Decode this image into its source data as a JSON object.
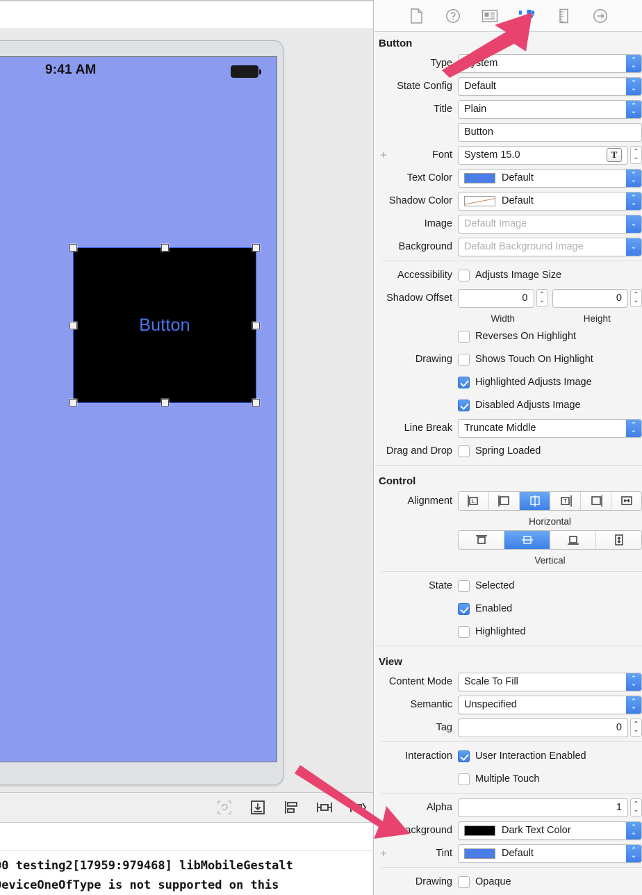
{
  "canvas": {
    "status_time": "9:41 AM",
    "button_label": "Button",
    "battery_icon": "battery-icon",
    "toolbar_icons": [
      {
        "name": "update-frames-icon",
        "glyph": "⟳",
        "disabled": true
      },
      {
        "name": "embed-in-icon",
        "glyph": "⤓",
        "disabled": false
      },
      {
        "name": "align-icon",
        "glyph": "⊟",
        "disabled": false
      },
      {
        "name": "pin-icon",
        "glyph": "⊦⊣",
        "disabled": false
      },
      {
        "name": "resolve-auto-layout-icon",
        "glyph": "⊦⊿",
        "disabled": false
      }
    ],
    "console_lines": [
      "00 testing2[17959:979468] libMobileGestalt",
      "DeviceOneOfType is not supported on this"
    ]
  },
  "inspector": {
    "tabs": [
      {
        "name": "file-inspector-tab",
        "icon": "file-icon",
        "active": false
      },
      {
        "name": "quick-help-inspector-tab",
        "icon": "question-circle-icon",
        "active": false
      },
      {
        "name": "identity-inspector-tab",
        "icon": "identity-card-icon",
        "active": false
      },
      {
        "name": "attributes-inspector-tab",
        "icon": "attributes-slider-icon",
        "active": true
      },
      {
        "name": "size-inspector-tab",
        "icon": "ruler-icon",
        "active": false
      },
      {
        "name": "connections-inspector-tab",
        "icon": "arrow-circle-icon",
        "active": false
      }
    ],
    "button_section": {
      "title": "Button",
      "type_label": "Type",
      "type_value": "System",
      "state_config_label": "State Config",
      "state_config_value": "Default",
      "title_label": "Title",
      "title_style_value": "Plain",
      "title_text_value": "Button",
      "font_label": "Font",
      "font_value": "System 15.0",
      "font_icon": "T",
      "text_color_label": "Text Color",
      "text_color_value": "Default",
      "text_color_swatch": "#4a7ee6",
      "shadow_color_label": "Shadow Color",
      "shadow_color_value": "Default",
      "image_label": "Image",
      "image_placeholder": "Default Image",
      "background_image_label": "Background",
      "background_image_placeholder": "Default Background Image",
      "accessibility_label": "Accessibility",
      "accessibility_option": "Adjusts Image Size",
      "accessibility_checked": false,
      "shadow_offset_label": "Shadow Offset",
      "shadow_offset_width": "0",
      "shadow_offset_height": "0",
      "width_caption": "Width",
      "height_caption": "Height",
      "drawing_label": "Drawing",
      "drawing_options": [
        {
          "label": "Reverses On Highlight",
          "checked": false
        },
        {
          "label": "Shows Touch On Highlight",
          "checked": false
        },
        {
          "label": "Highlighted Adjusts Image",
          "checked": true
        },
        {
          "label": "Disabled Adjusts Image",
          "checked": true
        }
      ],
      "line_break_label": "Line Break",
      "line_break_value": "Truncate Middle",
      "drag_drop_label": "Drag and Drop",
      "drag_drop_option": "Spring Loaded",
      "drag_drop_checked": false
    },
    "control_section": {
      "title": "Control",
      "alignment_label": "Alignment",
      "horizontal_caption": "Horizontal",
      "vertical_caption": "Vertical",
      "horizontal_segments": [
        {
          "name": "align-left",
          "glyph": "L",
          "selected": false
        },
        {
          "name": "align-leading",
          "glyph": "",
          "selected": false
        },
        {
          "name": "align-center",
          "glyph": "",
          "selected": true
        },
        {
          "name": "align-trailing",
          "glyph": "T",
          "selected": false
        },
        {
          "name": "align-right",
          "glyph": "",
          "selected": false
        },
        {
          "name": "align-fill-horizontal",
          "glyph": "↔",
          "selected": false
        }
      ],
      "vertical_segments": [
        {
          "name": "align-top",
          "glyph": "",
          "selected": false
        },
        {
          "name": "align-middle",
          "glyph": "",
          "selected": true
        },
        {
          "name": "align-bottom",
          "glyph": "",
          "selected": false
        },
        {
          "name": "align-fill-vertical",
          "glyph": "↕",
          "selected": false
        }
      ],
      "state_label": "State",
      "state_options": [
        {
          "label": "Selected",
          "checked": false
        },
        {
          "label": "Enabled",
          "checked": true
        },
        {
          "label": "Highlighted",
          "checked": false
        }
      ]
    },
    "view_section": {
      "title": "View",
      "content_mode_label": "Content Mode",
      "content_mode_value": "Scale To Fill",
      "semantic_label": "Semantic",
      "semantic_value": "Unspecified",
      "tag_label": "Tag",
      "tag_value": "0",
      "interaction_label": "Interaction",
      "interaction_options": [
        {
          "label": "User Interaction Enabled",
          "checked": true
        },
        {
          "label": "Multiple Touch",
          "checked": false
        }
      ],
      "alpha_label": "Alpha",
      "alpha_value": "1",
      "background_label": "Background",
      "background_value": "Dark Text Color",
      "background_swatch": "#000000",
      "tint_label": "Tint",
      "tint_value": "Default",
      "tint_swatch": "#4a7ee6",
      "drawing_label": "Drawing",
      "drawing_option": "Opaque",
      "drawing_checked": false
    }
  },
  "annotations": {
    "accent_color": "#e8436f",
    "arrow_1_target": "attributes-inspector-tab",
    "arrow_2_target": "background-color-row"
  }
}
